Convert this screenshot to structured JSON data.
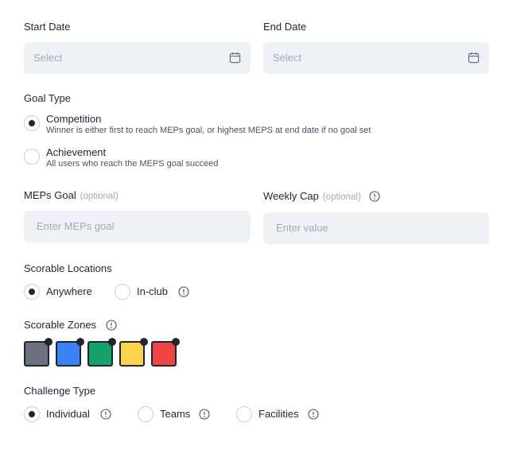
{
  "start_date": {
    "label": "Start Date",
    "placeholder": "Select"
  },
  "end_date": {
    "label": "End Date",
    "placeholder": "Select"
  },
  "goal_type": {
    "label": "Goal Type",
    "options": [
      {
        "label": "Competition",
        "description": "Winner is either first to reach MEPs goal, or highest MEPS at end date if no goal set",
        "selected": true
      },
      {
        "label": "Achievement",
        "description": "All users who reach the MEPS goal succeed",
        "selected": false
      }
    ]
  },
  "meps_goal": {
    "label": "MEPs Goal",
    "optional": "(optional)",
    "placeholder": "Enter MEPs goal"
  },
  "weekly_cap": {
    "label": "Weekly Cap",
    "optional": "(optional)",
    "placeholder": "Enter value"
  },
  "scorable_locations": {
    "label": "Scorable Locations",
    "options": [
      {
        "label": "Anywhere",
        "selected": true
      },
      {
        "label": "In-club",
        "selected": false
      }
    ]
  },
  "scorable_zones": {
    "label": "Scorable Zones",
    "zones": [
      {
        "color": "#6b7280",
        "selected": true
      },
      {
        "color": "#3b82f6",
        "selected": true
      },
      {
        "color": "#16a36a",
        "selected": true
      },
      {
        "color": "#fcd34d",
        "selected": true
      },
      {
        "color": "#ef4444",
        "selected": true
      }
    ]
  },
  "challenge_type": {
    "label": "Challenge Type",
    "options": [
      {
        "label": "Individual",
        "selected": true
      },
      {
        "label": "Teams",
        "selected": false
      },
      {
        "label": "Facilities",
        "selected": false
      }
    ]
  },
  "colors": {
    "text": "#1f2533",
    "field_bg": "#eef1f6",
    "muted": "#a2a9b6"
  }
}
